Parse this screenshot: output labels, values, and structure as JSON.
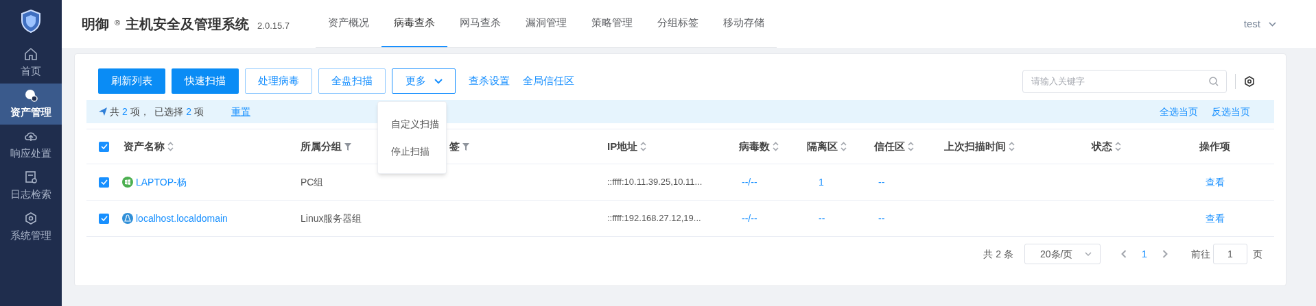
{
  "sidebar": {
    "items": [
      {
        "label": "首页",
        "selected": false
      },
      {
        "label": "资产管理",
        "selected": true
      },
      {
        "label": "响应处置",
        "selected": false
      },
      {
        "label": "日志检索",
        "selected": false
      },
      {
        "label": "系统管理",
        "selected": false
      }
    ]
  },
  "header": {
    "brand": "明御",
    "reg_mark": "®",
    "product": "主机安全及管理系统",
    "version": "2.0.15.7",
    "nav": [
      {
        "label": "资产概况",
        "selected": false
      },
      {
        "label": "病毒查杀",
        "selected": true
      },
      {
        "label": "网马查杀",
        "selected": false
      },
      {
        "label": "漏洞管理",
        "selected": false
      },
      {
        "label": "策略管理",
        "selected": false
      },
      {
        "label": "分组标签",
        "selected": false
      },
      {
        "label": "移动存储",
        "selected": false
      }
    ],
    "user": "test"
  },
  "toolbar": {
    "buttons": [
      {
        "label": "刷新列表",
        "kind": "primary"
      },
      {
        "label": "快速扫描",
        "kind": "primary"
      },
      {
        "label": "处理病毒",
        "kind": "outline"
      },
      {
        "label": "全盘扫描",
        "kind": "outline"
      },
      {
        "label": "更多",
        "kind": "dropdown",
        "expanded": true
      },
      {
        "label": "查杀设置",
        "kind": "link"
      },
      {
        "label": "全局信任区",
        "kind": "link"
      }
    ],
    "menu": [
      "自定义扫描",
      "停止扫描"
    ],
    "search": {
      "placeholder": "请输入关键字"
    }
  },
  "selection_bar": {
    "parts": [
      {
        "text": "共 ",
        "kind": "text"
      },
      {
        "text": "2",
        "kind": "count"
      },
      {
        "text": " 项，  已选择 ",
        "kind": "text"
      },
      {
        "text": "2",
        "kind": "count"
      },
      {
        "text": " 项",
        "kind": "text"
      }
    ],
    "reset": "重置",
    "actions": [
      "全选当页",
      "反选当页"
    ]
  },
  "table": {
    "all_checked": true,
    "columns": [
      {
        "label": "资产名称",
        "kind": "sortable"
      },
      {
        "label": "所属分组",
        "kind": "filterable"
      },
      {
        "label": "签",
        "kind": "filterable"
      },
      {
        "label": "IP地址",
        "kind": "sortable"
      },
      {
        "label": "病毒数",
        "kind": "sortable"
      },
      {
        "label": "隔离区",
        "kind": "sortable"
      },
      {
        "label": "信任区",
        "kind": "sortable"
      },
      {
        "label": "上次扫描时间",
        "kind": "sortable"
      },
      {
        "label": "状态",
        "kind": "sortable"
      },
      {
        "label": "操作项",
        "kind": "plain"
      }
    ],
    "rows": [
      {
        "checked": true,
        "kind": "windows",
        "name": "LAPTOP-杨",
        "group": "PC组",
        "ip": "::ffff:10.11.39.25,10.11...",
        "virus": "--/--",
        "quarantine": "1",
        "trust": "--",
        "action": "查看"
      },
      {
        "checked": true,
        "kind": "linux",
        "name": "localhost.localdomain",
        "group": "Linux服务器组",
        "ip": "::ffff:192.168.27.12,19...",
        "virus": "--/--",
        "quarantine": "--",
        "trust": "--",
        "action": "查看"
      }
    ]
  },
  "pagination": {
    "total": "共 2 条",
    "page_size": "20条/页",
    "pages": [
      {
        "label": "1",
        "selected": true
      }
    ],
    "goto_label": "前往",
    "goto_value": "1",
    "page_suffix": "页"
  }
}
